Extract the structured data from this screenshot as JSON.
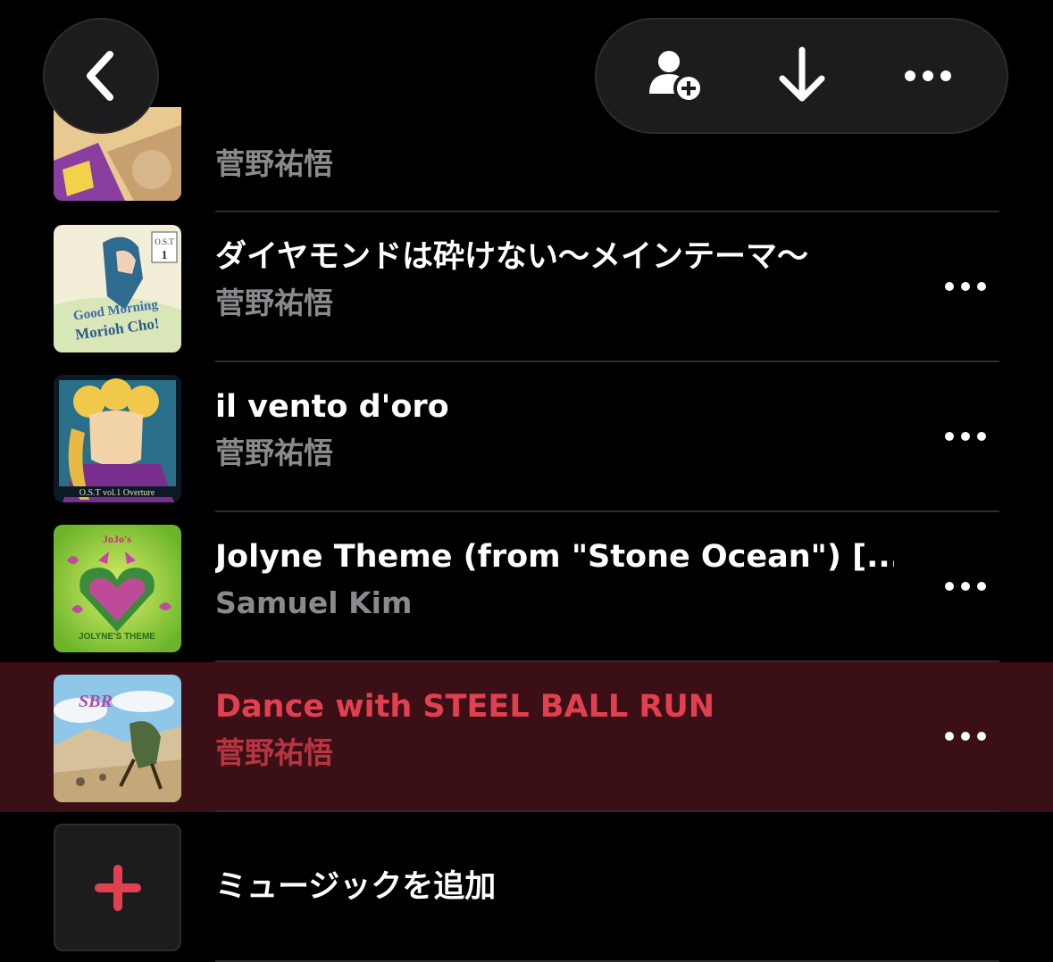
{
  "tracks": [
    {
      "title": "",
      "artist": "菅野祐悟",
      "art": "jojo-land"
    },
    {
      "title": "ダイヤモンドは砕けない～メインテーマ～",
      "artist": "菅野祐悟",
      "art": "morioh-cho"
    },
    {
      "title": "il vento d'oro",
      "artist": "菅野祐悟",
      "art": "giorno"
    },
    {
      "title": "Jolyne Theme (from \"Stone Ocean\") [...",
      "artist": "Samuel Kim",
      "art": "jolyne"
    },
    {
      "title": "Dance with STEEL BALL RUN",
      "artist": "菅野祐悟",
      "art": "steel-ball-run",
      "playing": true
    }
  ],
  "add_music": {
    "label": "ミュージックを追加"
  },
  "colors": {
    "accent": "#e0404f",
    "playing_bg": "#3a0f15",
    "secondary_text": "#8a8a8e"
  },
  "icons": {
    "back": "chevron-left-icon",
    "add_user": "person-add-icon",
    "download": "arrow-down-icon",
    "more": "ellipsis-icon",
    "add": "plus-icon"
  }
}
